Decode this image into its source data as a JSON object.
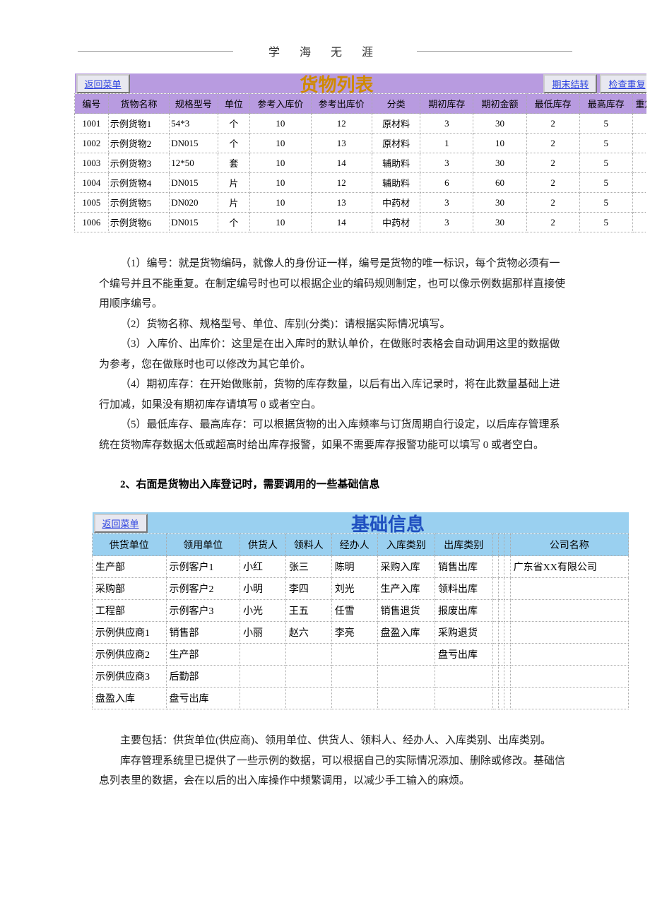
{
  "header": "学  海  无  涯",
  "table1": {
    "return_btn": "返回菜单",
    "title": "货物列表",
    "rollover_btn": "期末结转",
    "check_btn": "检查重复",
    "headers": [
      "编号",
      "货物名称",
      "规格型号",
      "单位",
      "参考入库价",
      "参考出库价",
      "分类",
      "期初库存",
      "期初金额",
      "最低库存",
      "最高库存",
      "重复"
    ],
    "rows": [
      {
        "id": "1001",
        "name": "示例货物1",
        "spec": "54*3",
        "unit": "个",
        "inp": "10",
        "outp": "12",
        "cat": "原材料",
        "qc": "3",
        "qa": "30",
        "min": "2",
        "max": "5",
        "dup": ""
      },
      {
        "id": "1002",
        "name": "示例货物2",
        "spec": "DN015",
        "unit": "个",
        "inp": "10",
        "outp": "13",
        "cat": "原材料",
        "qc": "1",
        "qa": "10",
        "min": "2",
        "max": "5",
        "dup": ""
      },
      {
        "id": "1003",
        "name": "示例货物3",
        "spec": "12*50",
        "unit": "套",
        "inp": "10",
        "outp": "14",
        "cat": "辅助料",
        "qc": "3",
        "qa": "30",
        "min": "2",
        "max": "5",
        "dup": ""
      },
      {
        "id": "1004",
        "name": "示例货物4",
        "spec": "DN015",
        "unit": "片",
        "inp": "10",
        "outp": "12",
        "cat": "辅助料",
        "qc": "6",
        "qa": "60",
        "min": "2",
        "max": "5",
        "dup": ""
      },
      {
        "id": "1005",
        "name": "示例货物5",
        "spec": "DN020",
        "unit": "片",
        "inp": "10",
        "outp": "13",
        "cat": "中药材",
        "qc": "3",
        "qa": "30",
        "min": "2",
        "max": "5",
        "dup": ""
      },
      {
        "id": "1006",
        "name": "示例货物6",
        "spec": "DN015",
        "unit": "个",
        "inp": "10",
        "outp": "14",
        "cat": "中药材",
        "qc": "3",
        "qa": "30",
        "min": "2",
        "max": "5",
        "dup": ""
      }
    ]
  },
  "desc1": {
    "p1": "（1）编号：就是货物编码，就像人的身份证一样，编号是货物的唯一标识，每个货物必须有一个编号并且不能重复。在制定编号时也可以根据企业的编码规则制定，也可以像示例数据那样直接使用顺序编号。",
    "p2": "（2）货物名称、规格型号、单位、库别(分类)：请根据实际情况填写。",
    "p3": "（3）入库价、出库价：这里是在出入库时的默认单价，在做账时表格会自动调用这里的数据做为参考，您在做账时也可以修改为其它单价。",
    "p4": "（4）期初库存：在开始做账前，货物的库存数量，以后有出入库记录时，将在此数量基础上进行加减，如果没有期初库存请填写 0 或者空白。",
    "p5": "（5）最低库存、最高库存：可以根据货物的出入库频率与订货周期自行设定，以后库存管理系统在货物库存数据太低或超高时给出库存报警，如果不需要库存报警功能可以填写 0 或者空白。"
  },
  "section2_title": "2、右面是货物出入库登记时，需要调用的一些基础信息",
  "table2": {
    "return_btn": "返回菜单",
    "title": "基础信息",
    "headers": [
      "供货单位",
      "领用单位",
      "供货人",
      "领料人",
      "经办人",
      "入库类别",
      "出库类别",
      "",
      "公司名称"
    ],
    "rows": [
      {
        "c0": "生产部",
        "c1": "示例客户1",
        "c2": "小红",
        "c3": "张三",
        "c4": "陈明",
        "c5": "采购入库",
        "c6": "销售出库",
        "c8": "广东省XX有限公司"
      },
      {
        "c0": "采购部",
        "c1": "示例客户2",
        "c2": "小明",
        "c3": "李四",
        "c4": "刘光",
        "c5": "生产入库",
        "c6": "领料出库",
        "c8": ""
      },
      {
        "c0": "工程部",
        "c1": "示例客户3",
        "c2": "小光",
        "c3": "王五",
        "c4": "任雪",
        "c5": "销售退货",
        "c6": "报废出库",
        "c8": ""
      },
      {
        "c0": "示例供应商1",
        "c1": "销售部",
        "c2": "小丽",
        "c3": "赵六",
        "c4": "李亮",
        "c5": "盘盈入库",
        "c6": "采购退货",
        "c8": ""
      },
      {
        "c0": "示例供应商2",
        "c1": "生产部",
        "c2": "",
        "c3": "",
        "c4": "",
        "c5": "",
        "c6": "盘亏出库",
        "c8": ""
      },
      {
        "c0": "示例供应商3",
        "c1": "后勤部",
        "c2": "",
        "c3": "",
        "c4": "",
        "c5": "",
        "c6": "",
        "c8": ""
      },
      {
        "c0": "盘盈入库",
        "c1": "盘亏出库",
        "c2": "",
        "c3": "",
        "c4": "",
        "c5": "",
        "c6": "",
        "c8": ""
      }
    ]
  },
  "desc2": {
    "p1": "主要包括：供货单位(供应商)、领用单位、供货人、领料人、经办人、入库类别、出库类别。",
    "p2": "库存管理系统里已提供了一些示例的数据，可以根据自己的实际情况添加、删除或修改。基础信息列表里的数据，会在以后的出入库操作中频繁调用，以减少手工输入的麻烦。"
  }
}
